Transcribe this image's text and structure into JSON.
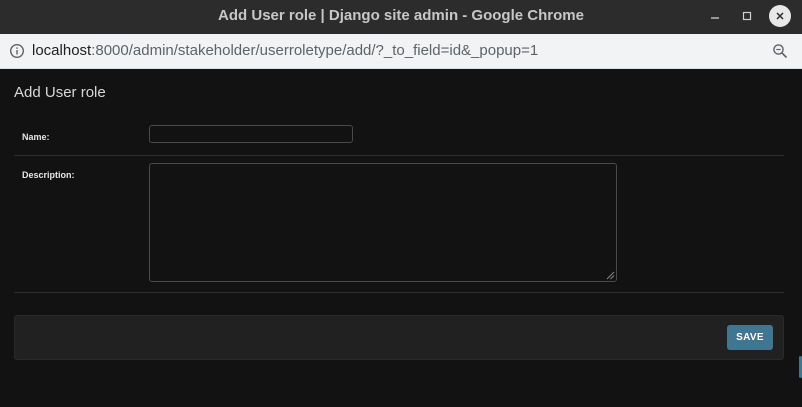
{
  "window": {
    "title": "Add User role | Django site admin - Google Chrome"
  },
  "address_bar": {
    "url_host": "localhost",
    "url_rest": ":8000/admin/stakeholder/userroletype/add/?_to_field=id&_popup=1"
  },
  "page": {
    "title": "Add User role"
  },
  "form": {
    "name_label": "Name:",
    "name_value": "",
    "description_label": "Description:",
    "description_value": ""
  },
  "submit": {
    "save_label": "SAVE"
  },
  "colors": {
    "accent": "#417690",
    "background": "#121212",
    "submit_row": "#212121"
  },
  "icons": {
    "info": "info-icon",
    "zoom": "zoom-icon",
    "minimize": "minimize-icon",
    "maximize": "maximize-icon",
    "close": "close-icon"
  }
}
